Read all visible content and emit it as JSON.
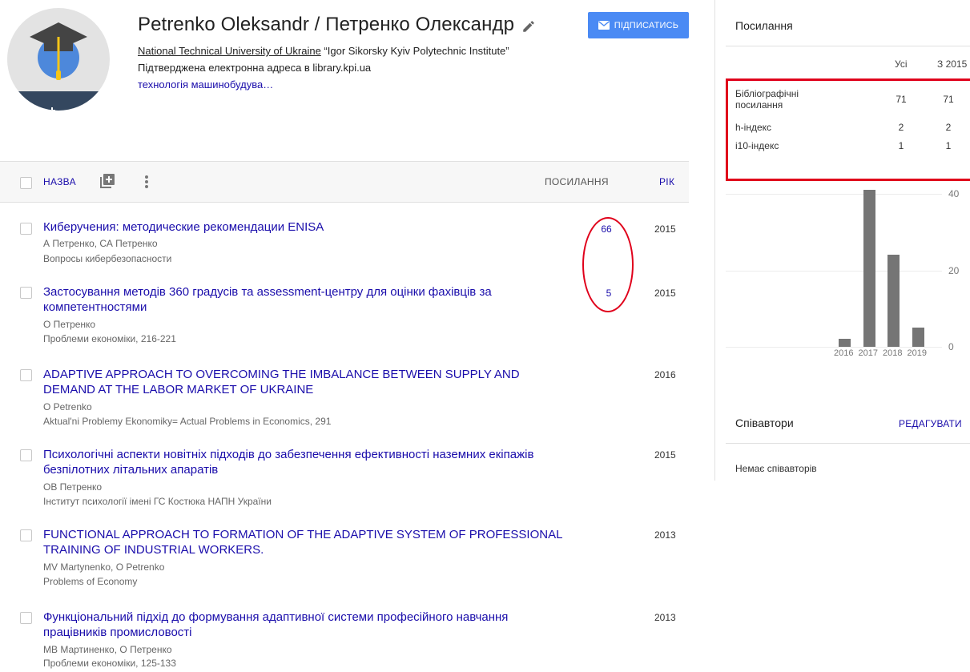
{
  "profile": {
    "name": "Petrenko Oleksandr / Петренко Олександр",
    "follow_label": "ПІДПИСАТИСЬ",
    "affiliation_link": "National Technical University of Ukraine",
    "affiliation_rest": " “Igor Sikorsky Kyiv Polytechnic Institute”",
    "email_verified": "Підтверджена електронна адреса в library.kpi.ua",
    "interests": "технологія машинобудува…"
  },
  "table": {
    "col_title": "НАЗВА",
    "col_citations": "ПОСИЛАННЯ",
    "col_year": "РІК"
  },
  "articles": [
    {
      "title": "Киберучения: методические рекомендации ENISA",
      "authors": "А  Петренко, СА Петренко",
      "venue": "Вопросы кибербезопасности",
      "citations": "66",
      "year": "2015"
    },
    {
      "title": "Застосування методів 360 градусів та assessment-центру для оцінки фахівців за компетентностями",
      "authors": "О  Петренко",
      "venue": "Проблеми економіки, 216-221",
      "citations": "5",
      "year": "2015"
    },
    {
      "title": "ADAPTIVE APPROACH TO OVERCOMING THE IMBALANCE BETWEEN SUPPLY AND DEMAND AT THE LABOR MARKET OF UKRAINE",
      "authors": "O  Petrenko",
      "venue": "Aktual'ni Problemy Ekonomiky= Actual Problems in Economics, 291",
      "citations": "",
      "year": "2016"
    },
    {
      "title": "Психологічні аспекти новітніх підходів до забезпечення ефективності наземних екіпажів безпілотних літальних апаратів",
      "authors": "ОВ Петренко",
      "venue": "Інститут психології імені ГС Костюка НАПН України",
      "citations": "",
      "year": "2015"
    },
    {
      "title": "FUNCTIONAL APPROACH TO FORMATION OF THE ADAPTIVE SYSTEM OF PROFESSIONAL TRAINING OF INDUSTRIAL WORKERS.",
      "authors": "MV Martynenko, O  Petrenko",
      "venue": "Problems of Economy",
      "citations": "",
      "year": "2013"
    },
    {
      "title": "Функціональний підхід до формування адаптивної системи професійного навчання працівників промисловості",
      "authors": "МВ Мартиненко, О  Петренко",
      "venue": "Проблеми економіки, 125-133",
      "citations": "",
      "year": "2013"
    }
  ],
  "citations_panel": {
    "heading": "Посилання",
    "col_all": "Усі",
    "col_since": "З 2015",
    "rows": [
      {
        "label_line1": "Бібліографічні",
        "label_line2": "посилання",
        "all": "71",
        "since": "71"
      },
      {
        "label_line1": "h-індекс",
        "label_line2": "",
        "all": "2",
        "since": "2"
      },
      {
        "label_line1": "i10-індекс",
        "label_line2": "",
        "all": "1",
        "since": "1"
      }
    ]
  },
  "chart_data": {
    "type": "bar",
    "categories": [
      "2016",
      "2017",
      "2018",
      "2019"
    ],
    "values": [
      2,
      41,
      24,
      5
    ],
    "ylim": [
      0,
      40
    ],
    "yticks": [
      "0",
      "20",
      "40"
    ],
    "grid": true,
    "bar_color": "#757575"
  },
  "coauthors": {
    "heading": "Співавтори",
    "edit_label": "РЕДАГУВАТИ",
    "empty_text": "Немає співавторів"
  },
  "colors": {
    "link": "#1a0dab",
    "follow_button": "#4a8af4",
    "annotation_red": "#e0001b"
  }
}
